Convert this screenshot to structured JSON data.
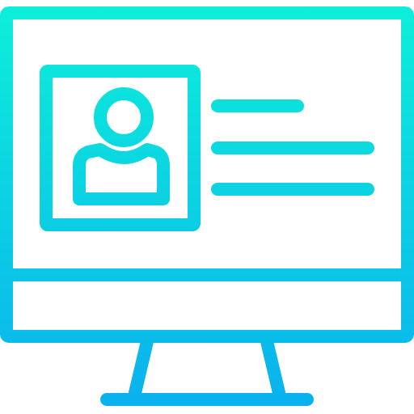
{
  "icon": {
    "name": "computer-profile-icon",
    "parts": [
      "monitor-icon",
      "user-avatar-icon",
      "text-line"
    ],
    "gradient": {
      "top_color": "#0df0d9",
      "bottom_color": "#0ab0ee"
    },
    "text_lines_count": 3
  }
}
